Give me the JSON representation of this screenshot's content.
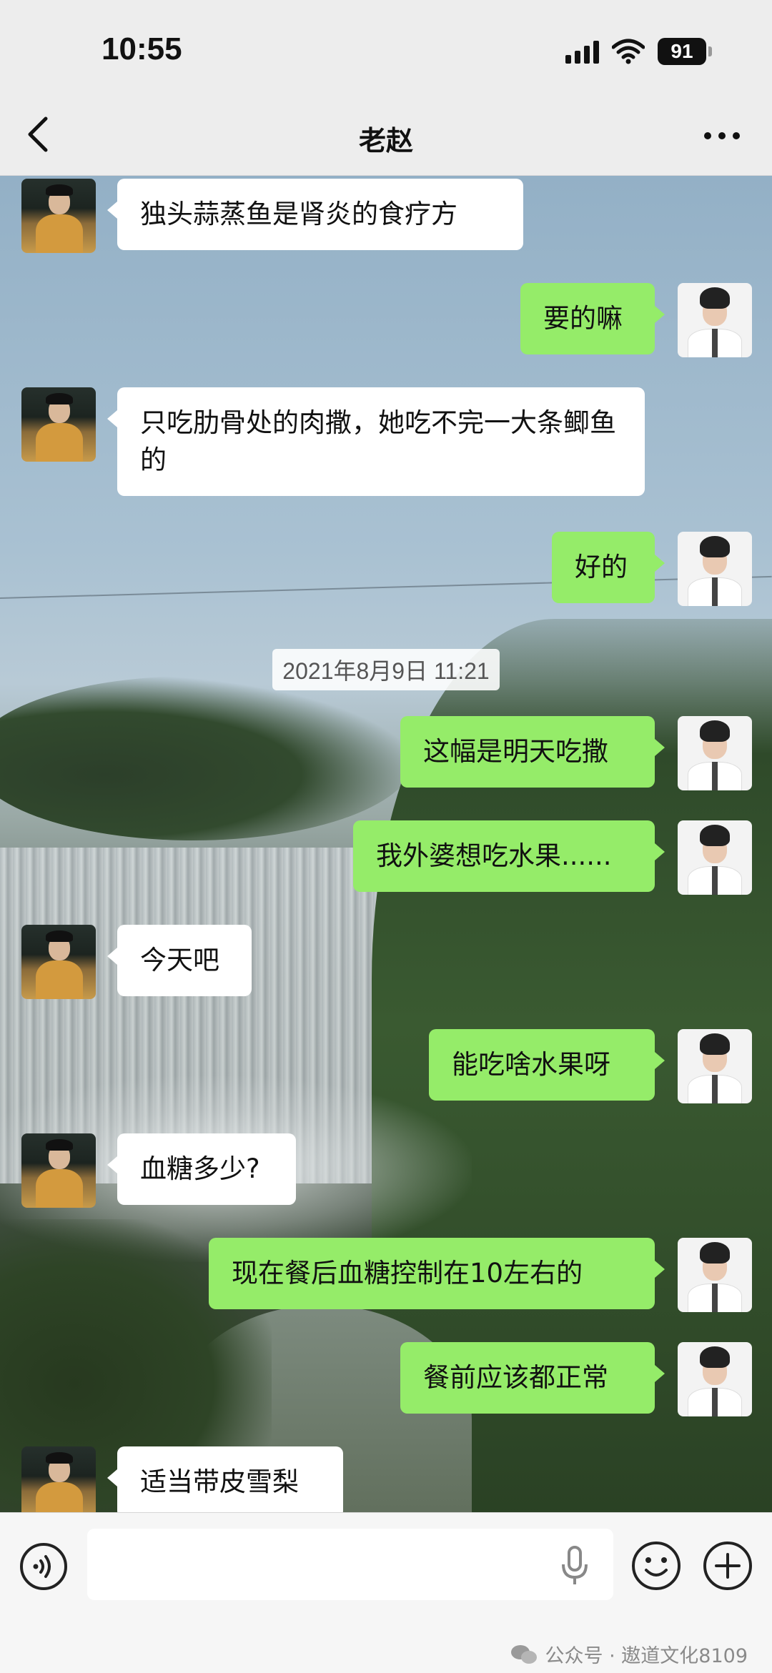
{
  "status_bar": {
    "time": "10:55",
    "battery": "91",
    "icons": [
      "signal-icon",
      "wifi-icon",
      "battery-icon"
    ]
  },
  "header": {
    "title": "老赵",
    "back_icon": "chevron-left-icon",
    "more_icon": "more-dots-icon"
  },
  "messages": [
    {
      "from": "friend",
      "text": "独头蒜蒸鱼是肾炎的食疗方"
    },
    {
      "from": "me",
      "text": "要的嘛"
    },
    {
      "from": "friend",
      "text": "只吃肋骨处的肉撒，她吃不完一大条鲫鱼的"
    },
    {
      "from": "me",
      "text": "好的"
    },
    {
      "from": "me",
      "text": "这幅是明天吃撒"
    },
    {
      "from": "me",
      "text": "我外婆想吃水果......"
    },
    {
      "from": "friend",
      "text": "今天吧"
    },
    {
      "from": "me",
      "text": "能吃啥水果呀"
    },
    {
      "from": "friend",
      "text": "血糖多少?"
    },
    {
      "from": "me",
      "text": "现在餐后血糖控制在10左右的"
    },
    {
      "from": "me",
      "text": "餐前应该都正常"
    },
    {
      "from": "friend",
      "text": "适当带皮雪梨"
    }
  ],
  "timestamp": "2021年8月9日 11:21",
  "input_bar": {
    "text_value": "",
    "icons": [
      "voice-icon",
      "mic-icon",
      "emoji-icon",
      "plus-icon"
    ]
  },
  "watermark": {
    "text": "公众号 · 遨道文化8109"
  },
  "colors": {
    "my_bubble": "#95ec69",
    "friend_bubble": "#ffffff",
    "header_bg": "#ededed"
  }
}
